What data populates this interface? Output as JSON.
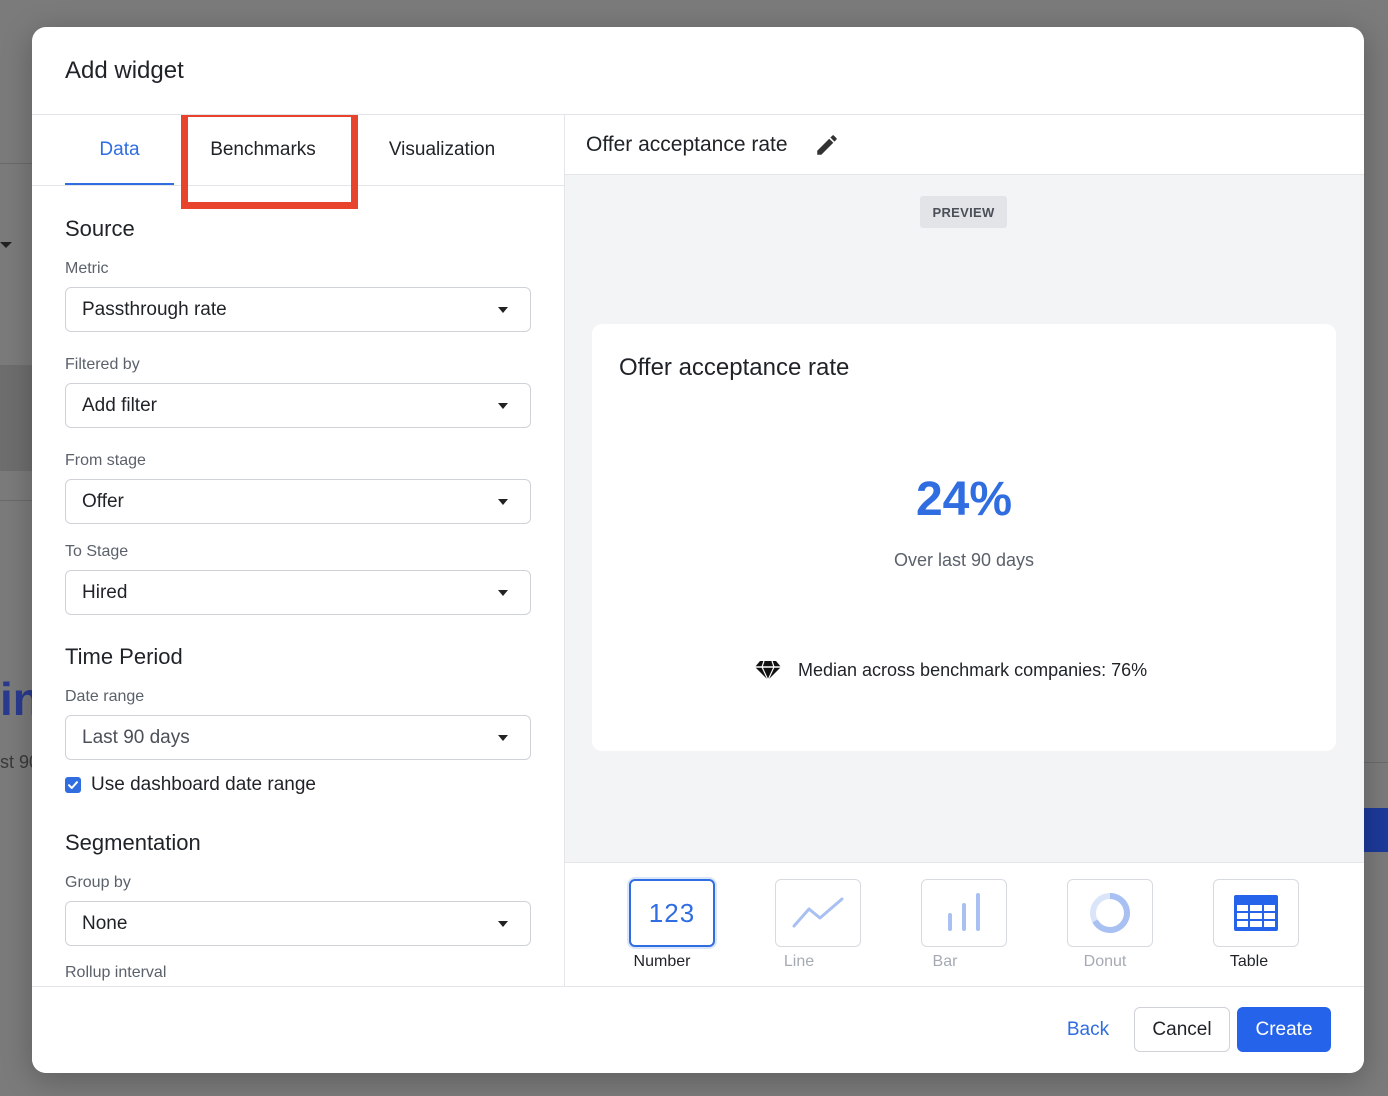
{
  "background": {
    "fragment_large": "in",
    "fragment_small": "st 90"
  },
  "modal": {
    "title": "Add widget"
  },
  "tabs": [
    {
      "label": "Data",
      "active": true
    },
    {
      "label": "Benchmarks",
      "active": false,
      "highlighted": true
    },
    {
      "label": "Visualization",
      "active": false
    }
  ],
  "form": {
    "source_title": "Source",
    "metric": {
      "label": "Metric",
      "value": "Passthrough rate"
    },
    "filtered_by": {
      "label": "Filtered by",
      "value": "Add filter"
    },
    "from_stage": {
      "label": "From stage",
      "value": "Offer"
    },
    "to_stage": {
      "label": "To Stage",
      "value": "Hired"
    },
    "time_period_title": "Time Period",
    "date_range": {
      "label": "Date range",
      "value": "Last 90 days"
    },
    "use_dashboard_date_range": {
      "label": "Use dashboard date range",
      "checked": true
    },
    "segmentation_title": "Segmentation",
    "group_by": {
      "label": "Group by",
      "value": "None"
    },
    "rollup_interval": {
      "label": "Rollup interval"
    }
  },
  "preview": {
    "widget_name": "Offer acceptance rate",
    "badge": "PREVIEW",
    "card": {
      "title": "Offer acceptance rate",
      "value": "24%",
      "subtitle": "Over last 90 days",
      "benchmark_text": "Median across benchmark companies: 76%"
    }
  },
  "visualizations": [
    {
      "label": "Number",
      "icon": "number-icon",
      "glyph": "123",
      "selected": true,
      "enabled": true
    },
    {
      "label": "Line",
      "icon": "line-chart-icon",
      "selected": false,
      "enabled": false
    },
    {
      "label": "Bar",
      "icon": "bar-chart-icon",
      "selected": false,
      "enabled": false
    },
    {
      "label": "Donut",
      "icon": "donut-chart-icon",
      "selected": false,
      "enabled": false
    },
    {
      "label": "Table",
      "icon": "table-icon",
      "selected": false,
      "enabled": true
    }
  ],
  "footer": {
    "back_label": "Back",
    "cancel_label": "Cancel",
    "create_label": "Create"
  },
  "colors": {
    "accent": "#2f6de0",
    "primary_button": "#2563eb",
    "highlight": "#e8432d",
    "preview_bg": "#f3f4f6"
  }
}
